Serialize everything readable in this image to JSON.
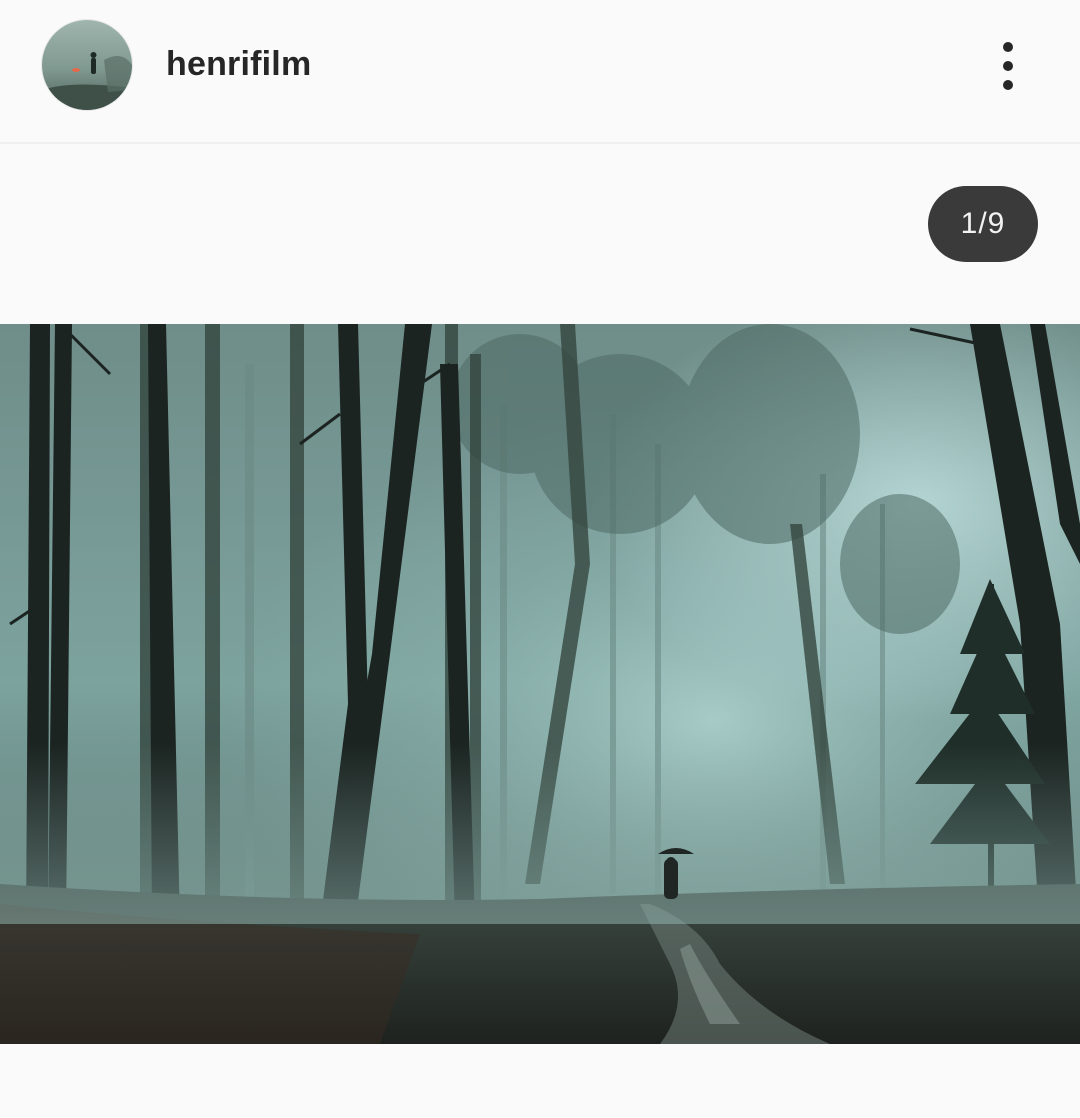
{
  "post": {
    "username": "henrifilm",
    "avatar_icon": "profile-avatar-icon",
    "more_options_icon": "more-vertical-icon",
    "carousel_counter": "1/9",
    "carousel_index": 1,
    "carousel_total": 9
  },
  "colors": {
    "background": "#fafafa",
    "text": "#262626",
    "badge_background": "#3a3a3a",
    "badge_text": "#f2f2f2"
  }
}
